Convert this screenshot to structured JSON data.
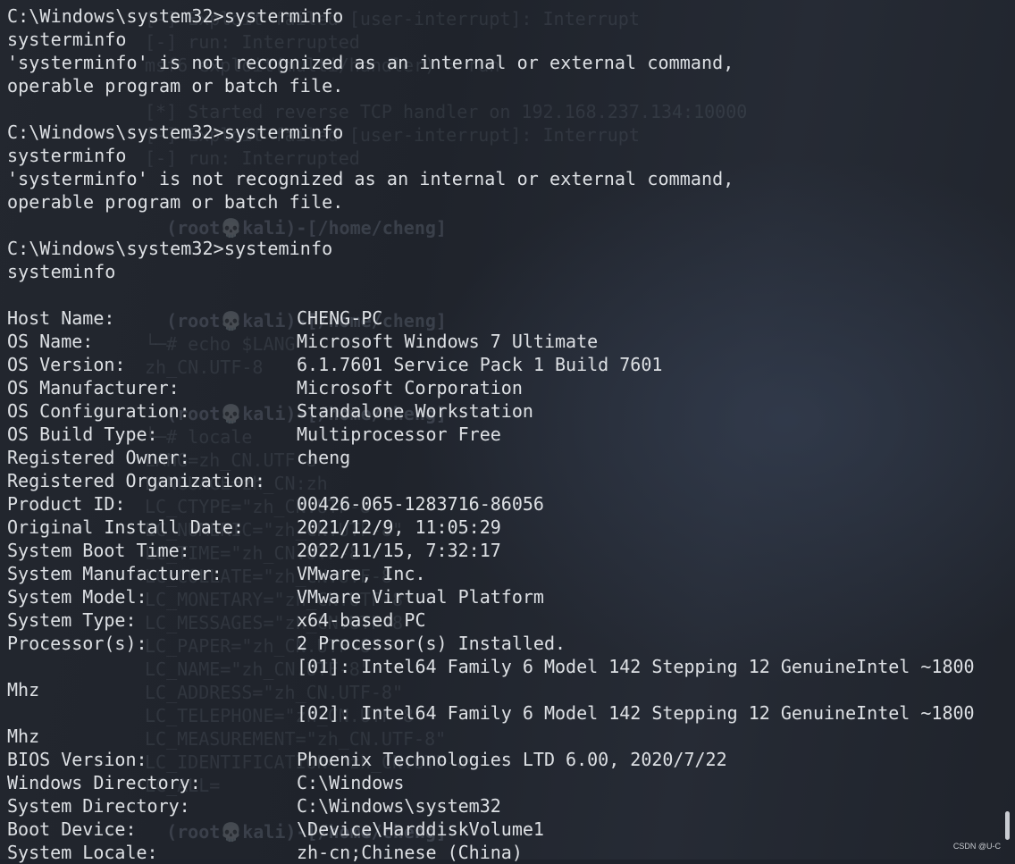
{
  "terminal": {
    "session_lines": [
      "C:\\Windows\\system32>systerminfo",
      "systerminfo",
      "'systerminfo' is not recognized as an internal or external command,",
      "operable program or batch file.",
      "",
      "C:\\Windows\\system32>systerminfo",
      "systerminfo",
      "'systerminfo' is not recognized as an internal or external command,",
      "operable program or batch file.",
      "",
      "C:\\Windows\\system32>systeminfo",
      "systeminfo",
      ""
    ],
    "systeminfo_rows": [
      {
        "label": "Host Name:",
        "value": "CHENG-PC"
      },
      {
        "label": "OS Name:",
        "value": "Microsoft Windows 7 Ultimate"
      },
      {
        "label": "OS Version:",
        "value": "6.1.7601 Service Pack 1 Build 7601"
      },
      {
        "label": "OS Manufacturer:",
        "value": "Microsoft Corporation"
      },
      {
        "label": "OS Configuration:",
        "value": "Standalone Workstation"
      },
      {
        "label": "OS Build Type:",
        "value": "Multiprocessor Free"
      },
      {
        "label": "Registered Owner:",
        "value": "cheng"
      },
      {
        "label": "Registered Organization:",
        "value": ""
      },
      {
        "label": "Product ID:",
        "value": "00426-065-1283716-86056"
      },
      {
        "label": "Original Install Date:",
        "value": "2021/12/9, 11:05:29"
      },
      {
        "label": "System Boot Time:",
        "value": "2022/11/15, 7:32:17"
      },
      {
        "label": "System Manufacturer:",
        "value": "VMware, Inc."
      },
      {
        "label": "System Model:",
        "value": "VMware Virtual Platform"
      },
      {
        "label": "System Type:",
        "value": "x64-based PC"
      },
      {
        "label": "Processor(s):",
        "value": "2 Processor(s) Installed."
      },
      {
        "label": "",
        "value": "[01]: Intel64 Family 6 Model 142 Stepping 12 GenuineIntel ~1800"
      },
      {
        "label": "Mhz",
        "value": ""
      },
      {
        "label": "",
        "value": "[02]: Intel64 Family 6 Model 142 Stepping 12 GenuineIntel ~1800"
      },
      {
        "label": "Mhz",
        "value": ""
      },
      {
        "label": "BIOS Version:",
        "value": "Phoenix Technologies LTD 6.00, 2020/7/22"
      },
      {
        "label": "Windows Directory:",
        "value": "C:\\Windows"
      },
      {
        "label": "System Directory:",
        "value": "C:\\Windows\\system32"
      },
      {
        "label": "Boot Device:",
        "value": "\\Device\\HarddiskVolume1"
      },
      {
        "label": "System Locale:",
        "value": "zh-cn;Chinese (China)"
      }
    ]
  },
  "background_ghost": {
    "lines": [
      "[-] Exploit failed [user-interrupt]: Interrupt",
      "[-] run: Interrupted",
      "msf6 exploit(multi/handler) > run",
      "",
      "[*] Started reverse TCP handler on 192.168.237.134:10000",
      "[-] Exploit failed [user-interrupt]: Interrupt",
      "[-] run: Interrupted",
      "",
      "",
      "  (root💀kali)-[/home/cheng]",
      "",
      "",
      "",
      "  (root💀kali)-[/home/cheng]",
      "└─# echo $LANG",
      "zh_CN.UTF-8",
      "",
      "  (root💀kali)-[/home/cheng]",
      "└─# locale",
      "LANG=zh_CN.UTF-8",
      "LANGUAGE=zh_CN:zh",
      "LC_CTYPE=\"zh_CN.UTF-8\"",
      "LC_NUMERIC=\"zh_CN.UTF-8\"",
      "LC_TIME=\"zh_CN.UTF-8\"",
      "LC_COLLATE=\"zh_CN.UTF-8\"",
      "LC_MONETARY=\"zh_CN.UTF-8\"",
      "LC_MESSAGES=\"zh_CN.UTF-8\"",
      "LC_PAPER=\"zh_CN.UTF-8\"",
      "LC_NAME=\"zh_CN.UTF-8\"",
      "LC_ADDRESS=\"zh_CN.UTF-8\"",
      "LC_TELEPHONE=\"zh_CN.UTF-8\"",
      "LC_MEASUREMENT=\"zh_CN.UTF-8\"",
      "LC_IDENTIFICATION=\"zh_CN.UTF-8\"",
      "LC_ALL=",
      "",
      "  (root💀kali)-[/home/cheng]"
    ],
    "strong_indexes": [
      9,
      13,
      17,
      35
    ]
  },
  "watermark": "CSDN @U-C",
  "colors": {
    "text": "#dde0e4",
    "background": "#1e222b"
  }
}
